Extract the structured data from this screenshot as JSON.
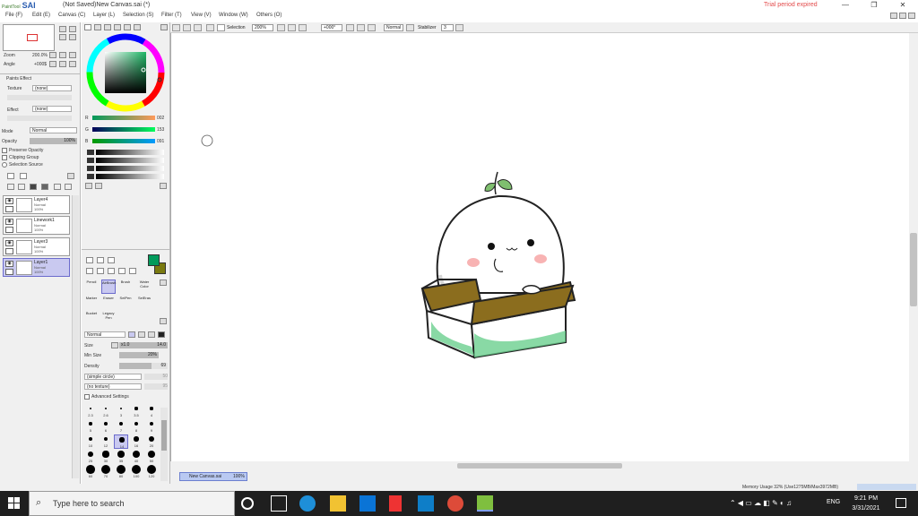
{
  "window": {
    "logo_small": "PaintTool",
    "logo_text": "SAI",
    "title": "(Not Saved)New Canvas.sai (*)",
    "trial_notice": "Trial period expired",
    "minimize": "—",
    "maximize": "❐",
    "close": "✕"
  },
  "menu": [
    "File (F)",
    "Edit (E)",
    "Canvas (C)",
    "Layer (L)",
    "Selection (S)",
    "Filter (T)",
    "View (V)",
    "Window (W)",
    "Others (O)"
  ],
  "navigator": {
    "zoom_label": "Zoom",
    "zoom_value": "200.0%",
    "angle_label": "Angle",
    "angle_value": "+000$"
  },
  "paint_effect": {
    "header": "Paints Effect",
    "texture_label": "Texture",
    "texture_value": "(none)",
    "effect_label": "Effect",
    "effect_value": "(none)"
  },
  "layer_props": {
    "mode_label": "Mode",
    "mode_value": "Normal",
    "opacity_label": "Opacity",
    "opacity_value": "100%",
    "preserve_opacity": "Preserve Opacity",
    "clipping_group": "Clipping Group",
    "selection_source": "Selection Source"
  },
  "layers": [
    {
      "name": "Layer4",
      "mode": "Normal",
      "opacity": "100%",
      "selected": false
    },
    {
      "name": "Linework1",
      "mode": "Normal",
      "opacity": "100%",
      "selected": false
    },
    {
      "name": "Layer3",
      "mode": "Normal",
      "opacity": "100%",
      "selected": false
    },
    {
      "name": "Layer1",
      "mode": "Normal",
      "opacity": "100%",
      "selected": true
    }
  ],
  "color": {
    "r_label": "R",
    "r_value": "002",
    "g_label": "G",
    "g_value": "153",
    "b_label": "B",
    "b_value": "091",
    "primary": "#029a5b",
    "secondary": "#7a7a10"
  },
  "toolbar": {
    "selection_label": "Selection",
    "zoom_value": "200%",
    "angle_value": "+000°",
    "blend_mode": "Normal",
    "stabilizer_label": "Stabilizer",
    "stabilizer_value": "3"
  },
  "tools": [
    {
      "name": "Pencil",
      "selected": false
    },
    {
      "name": "AirBrush",
      "selected": true
    },
    {
      "name": "Brush",
      "selected": false
    },
    {
      "name": "Water Color",
      "selected": false
    },
    {
      "name": "Marker",
      "selected": false
    },
    {
      "name": "Eraser",
      "selected": false
    },
    {
      "name": "SelPen",
      "selected": false
    },
    {
      "name": "SelEras",
      "selected": false
    },
    {
      "name": "Bucket",
      "selected": false
    },
    {
      "name": "Legacy Pen",
      "selected": false
    }
  ],
  "brush": {
    "mode": "Normal",
    "size_label": "Size",
    "size_multiplier": "x1.0",
    "size_value": "14.0",
    "min_size_label": "Min Size",
    "min_size_value": "20%",
    "density_label": "Density",
    "density_value": "69",
    "shape": "(simple circle)",
    "shape_value": "50",
    "texture": "(no texture)",
    "texture_value": "95",
    "advanced": "Advanced Settings"
  },
  "brush_sizes": [
    "2.3",
    "2.6",
    "3",
    "3.5",
    "4",
    "5",
    "6",
    "7",
    "8",
    "9",
    "10",
    "12",
    "14",
    "16",
    "20",
    "25",
    "30",
    "35",
    "40",
    "50",
    "60",
    "70",
    "80",
    "100",
    "120"
  ],
  "brush_size_selected": "14",
  "doc_tab": {
    "name": "New Canvas.sai",
    "zoom": "100%"
  },
  "status": {
    "memory": "Memory Usage 32% (Use1275MB/Max3972MB)"
  },
  "taskbar": {
    "search_placeholder": "Type here to search",
    "language": "ENG",
    "time": "9:21 PM",
    "date": "3/31/2021"
  }
}
